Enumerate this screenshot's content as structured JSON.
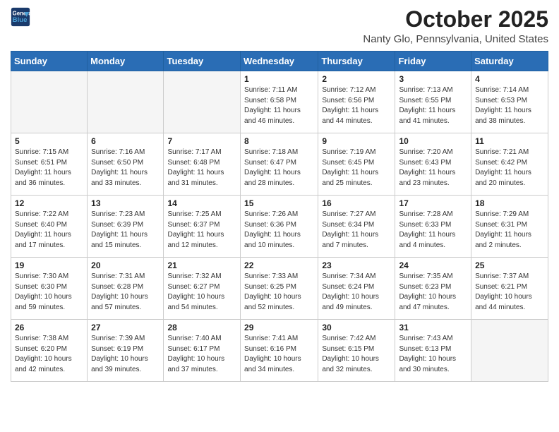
{
  "header": {
    "logo_line1": "General",
    "logo_line2": "Blue",
    "month": "October 2025",
    "location": "Nanty Glo, Pennsylvania, United States"
  },
  "days_of_week": [
    "Sunday",
    "Monday",
    "Tuesday",
    "Wednesday",
    "Thursday",
    "Friday",
    "Saturday"
  ],
  "weeks": [
    [
      {
        "day": "",
        "info": ""
      },
      {
        "day": "",
        "info": ""
      },
      {
        "day": "",
        "info": ""
      },
      {
        "day": "1",
        "info": "Sunrise: 7:11 AM\nSunset: 6:58 PM\nDaylight: 11 hours and 46 minutes."
      },
      {
        "day": "2",
        "info": "Sunrise: 7:12 AM\nSunset: 6:56 PM\nDaylight: 11 hours and 44 minutes."
      },
      {
        "day": "3",
        "info": "Sunrise: 7:13 AM\nSunset: 6:55 PM\nDaylight: 11 hours and 41 minutes."
      },
      {
        "day": "4",
        "info": "Sunrise: 7:14 AM\nSunset: 6:53 PM\nDaylight: 11 hours and 38 minutes."
      }
    ],
    [
      {
        "day": "5",
        "info": "Sunrise: 7:15 AM\nSunset: 6:51 PM\nDaylight: 11 hours and 36 minutes."
      },
      {
        "day": "6",
        "info": "Sunrise: 7:16 AM\nSunset: 6:50 PM\nDaylight: 11 hours and 33 minutes."
      },
      {
        "day": "7",
        "info": "Sunrise: 7:17 AM\nSunset: 6:48 PM\nDaylight: 11 hours and 31 minutes."
      },
      {
        "day": "8",
        "info": "Sunrise: 7:18 AM\nSunset: 6:47 PM\nDaylight: 11 hours and 28 minutes."
      },
      {
        "day": "9",
        "info": "Sunrise: 7:19 AM\nSunset: 6:45 PM\nDaylight: 11 hours and 25 minutes."
      },
      {
        "day": "10",
        "info": "Sunrise: 7:20 AM\nSunset: 6:43 PM\nDaylight: 11 hours and 23 minutes."
      },
      {
        "day": "11",
        "info": "Sunrise: 7:21 AM\nSunset: 6:42 PM\nDaylight: 11 hours and 20 minutes."
      }
    ],
    [
      {
        "day": "12",
        "info": "Sunrise: 7:22 AM\nSunset: 6:40 PM\nDaylight: 11 hours and 17 minutes."
      },
      {
        "day": "13",
        "info": "Sunrise: 7:23 AM\nSunset: 6:39 PM\nDaylight: 11 hours and 15 minutes."
      },
      {
        "day": "14",
        "info": "Sunrise: 7:25 AM\nSunset: 6:37 PM\nDaylight: 11 hours and 12 minutes."
      },
      {
        "day": "15",
        "info": "Sunrise: 7:26 AM\nSunset: 6:36 PM\nDaylight: 11 hours and 10 minutes."
      },
      {
        "day": "16",
        "info": "Sunrise: 7:27 AM\nSunset: 6:34 PM\nDaylight: 11 hours and 7 minutes."
      },
      {
        "day": "17",
        "info": "Sunrise: 7:28 AM\nSunset: 6:33 PM\nDaylight: 11 hours and 4 minutes."
      },
      {
        "day": "18",
        "info": "Sunrise: 7:29 AM\nSunset: 6:31 PM\nDaylight: 11 hours and 2 minutes."
      }
    ],
    [
      {
        "day": "19",
        "info": "Sunrise: 7:30 AM\nSunset: 6:30 PM\nDaylight: 10 hours and 59 minutes."
      },
      {
        "day": "20",
        "info": "Sunrise: 7:31 AM\nSunset: 6:28 PM\nDaylight: 10 hours and 57 minutes."
      },
      {
        "day": "21",
        "info": "Sunrise: 7:32 AM\nSunset: 6:27 PM\nDaylight: 10 hours and 54 minutes."
      },
      {
        "day": "22",
        "info": "Sunrise: 7:33 AM\nSunset: 6:25 PM\nDaylight: 10 hours and 52 minutes."
      },
      {
        "day": "23",
        "info": "Sunrise: 7:34 AM\nSunset: 6:24 PM\nDaylight: 10 hours and 49 minutes."
      },
      {
        "day": "24",
        "info": "Sunrise: 7:35 AM\nSunset: 6:23 PM\nDaylight: 10 hours and 47 minutes."
      },
      {
        "day": "25",
        "info": "Sunrise: 7:37 AM\nSunset: 6:21 PM\nDaylight: 10 hours and 44 minutes."
      }
    ],
    [
      {
        "day": "26",
        "info": "Sunrise: 7:38 AM\nSunset: 6:20 PM\nDaylight: 10 hours and 42 minutes."
      },
      {
        "day": "27",
        "info": "Sunrise: 7:39 AM\nSunset: 6:19 PM\nDaylight: 10 hours and 39 minutes."
      },
      {
        "day": "28",
        "info": "Sunrise: 7:40 AM\nSunset: 6:17 PM\nDaylight: 10 hours and 37 minutes."
      },
      {
        "day": "29",
        "info": "Sunrise: 7:41 AM\nSunset: 6:16 PM\nDaylight: 10 hours and 34 minutes."
      },
      {
        "day": "30",
        "info": "Sunrise: 7:42 AM\nSunset: 6:15 PM\nDaylight: 10 hours and 32 minutes."
      },
      {
        "day": "31",
        "info": "Sunrise: 7:43 AM\nSunset: 6:13 PM\nDaylight: 10 hours and 30 minutes."
      },
      {
        "day": "",
        "info": ""
      }
    ]
  ]
}
